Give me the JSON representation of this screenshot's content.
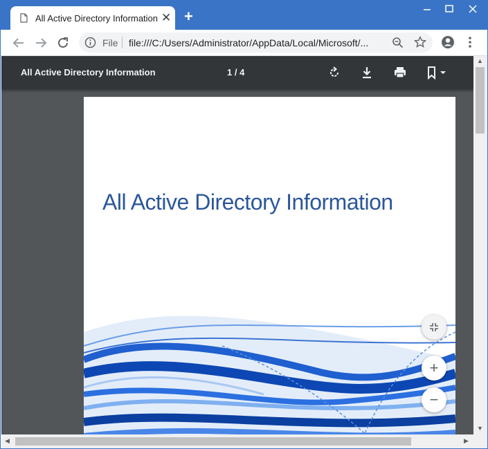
{
  "browser": {
    "tab_title": "All Active Directory Information",
    "tab_close": "✕",
    "new_tab": "+",
    "scheme_label": "File",
    "url": "file:///C:/Users/Administrator/AppData/Local/Microsoft/..."
  },
  "pdf_viewer": {
    "title": "All Active Directory Information",
    "page_indicator": "1 / 4",
    "buttons": [
      "rotate-icon",
      "download-icon",
      "print-icon",
      "bookmark-icon"
    ]
  },
  "document": {
    "heading": "All Active Directory Information"
  },
  "zoom": {
    "zoom_in": "+",
    "zoom_out": "−"
  },
  "colors": {
    "chrome_frame": "#3a74c6",
    "pdf_toolbar": "#323639",
    "viewer_bg": "#525659",
    "doc_heading": "#2b579a"
  }
}
